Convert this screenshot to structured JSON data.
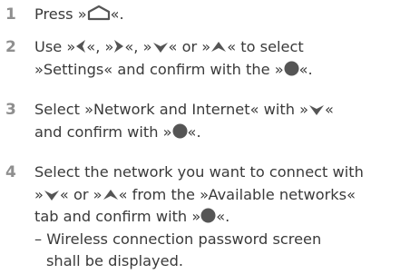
{
  "steps": [
    {
      "number": "1",
      "lines": [
        {
          "parts": [
            {
              "t": "Press »"
            },
            {
              "icon": "home-icon"
            },
            {
              "t": "«."
            }
          ]
        }
      ]
    },
    {
      "number": "2",
      "lines": [
        {
          "parts": [
            {
              "t": "Use »"
            },
            {
              "icon": "left-arrow-icon"
            },
            {
              "t": "«, »"
            },
            {
              "icon": "right-arrow-icon"
            },
            {
              "t": "«, »"
            },
            {
              "icon": "down-arrow-icon"
            },
            {
              "t": "« or »"
            },
            {
              "icon": "up-arrow-icon"
            },
            {
              "t": "« to select"
            }
          ]
        },
        {
          "parts": [
            {
              "t": "»Settings« and confirm with the »"
            },
            {
              "icon": "ok-button-icon"
            },
            {
              "t": "«."
            }
          ]
        }
      ]
    },
    {
      "number": "3",
      "lines": [
        {
          "parts": [
            {
              "t": "Select »Network and Internet« with »"
            },
            {
              "icon": "down-arrow-icon"
            },
            {
              "t": "«"
            }
          ]
        },
        {
          "parts": [
            {
              "t": "and confirm with »"
            },
            {
              "icon": "ok-button-icon"
            },
            {
              "t": "«."
            }
          ]
        }
      ]
    },
    {
      "number": "4",
      "lines": [
        {
          "parts": [
            {
              "t": "Select the network you want to connect with"
            }
          ]
        },
        {
          "parts": [
            {
              "t": "»"
            },
            {
              "icon": "down-arrow-icon"
            },
            {
              "t": "« or »"
            },
            {
              "icon": "up-arrow-icon"
            },
            {
              "t": "« from the »Available networks«"
            }
          ]
        },
        {
          "parts": [
            {
              "t": "tab and confirm with »"
            },
            {
              "icon": "ok-button-icon"
            },
            {
              "t": "«."
            }
          ]
        },
        {
          "parts": [
            {
              "t": "– Wireless connection password screen"
            }
          ]
        },
        {
          "parts": [
            {
              "t": "shall be displayed."
            }
          ],
          "indent": true
        }
      ]
    }
  ],
  "colors": {
    "text": "#3a3a3a",
    "step_number": "#8f8f8f",
    "icon": "#555555"
  }
}
